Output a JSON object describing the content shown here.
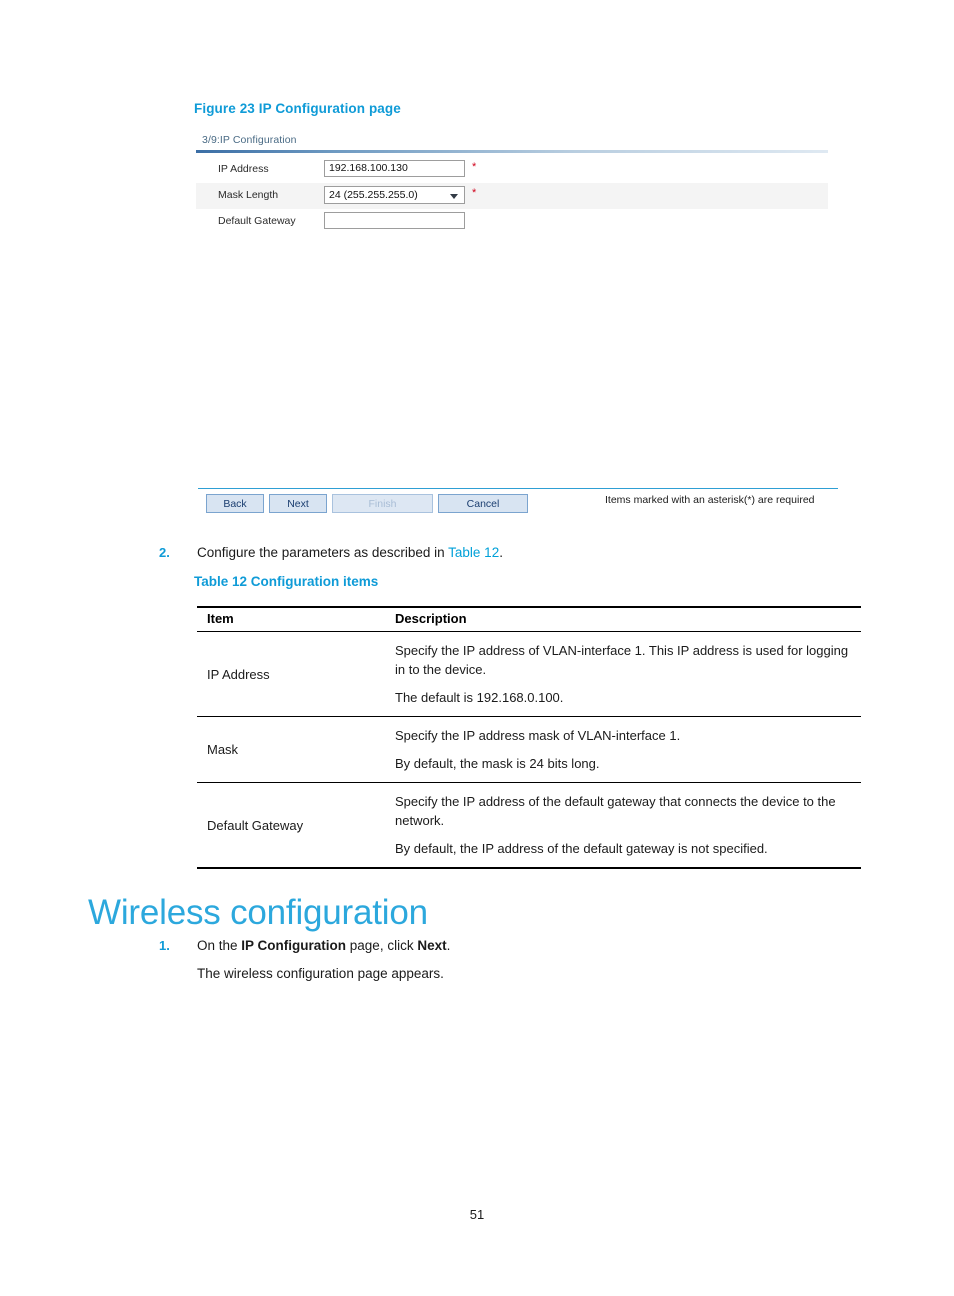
{
  "document": {
    "page_number": "51",
    "accent_color": "#0f9bd7",
    "heading_color": "#2ca8dd"
  },
  "figure": {
    "caption": "Figure 23 IP Configuration page",
    "wizard": {
      "tab_label": "3/9:IP Configuration",
      "fields": [
        {
          "label": "IP Address",
          "type": "text",
          "value": "192.168.100.130",
          "required_mark": "*"
        },
        {
          "label": "Mask Length",
          "type": "select",
          "value": "24 (255.255.255.0)",
          "required_mark": "*"
        },
        {
          "label": "Default Gateway",
          "type": "text",
          "value": "",
          "required_mark": ""
        }
      ],
      "buttons": [
        {
          "label": "Back",
          "disabled": false
        },
        {
          "label": "Next",
          "disabled": false
        },
        {
          "label": "Finish",
          "disabled": true
        },
        {
          "label": "Cancel",
          "disabled": false
        }
      ],
      "asterisk_note": "Items marked with an asterisk(*) are required"
    }
  },
  "step_2": {
    "number": "2.",
    "text_before_link": "Configure the parameters as described in ",
    "link_text": "Table 12",
    "text_after_link": "."
  },
  "table": {
    "caption": "Table 12 Configuration items",
    "headers": {
      "item": "Item",
      "description": "Description"
    },
    "rows": [
      {
        "item": "IP Address",
        "description_1": "Specify the IP address of VLAN-interface 1. This IP address is used for logging in to the device.",
        "description_2": "The default is 192.168.0.100."
      },
      {
        "item": "Mask",
        "description_1": "Specify the IP address mask of VLAN-interface 1.",
        "description_2": "By default, the mask is 24 bits long."
      },
      {
        "item": "Default Gateway",
        "description_1": "Specify the IP address of the default gateway that connects the device to the network.",
        "description_2": "By default, the IP address of the default gateway is not specified."
      }
    ]
  },
  "section": {
    "heading": "Wireless configuration"
  },
  "step_1": {
    "number": "1.",
    "text_part_1": "On the ",
    "bold_1": "IP Configuration",
    "text_part_2": " page, click ",
    "bold_2": "Next",
    "text_part_3": ".",
    "sub_text": "The wireless configuration page appears."
  }
}
